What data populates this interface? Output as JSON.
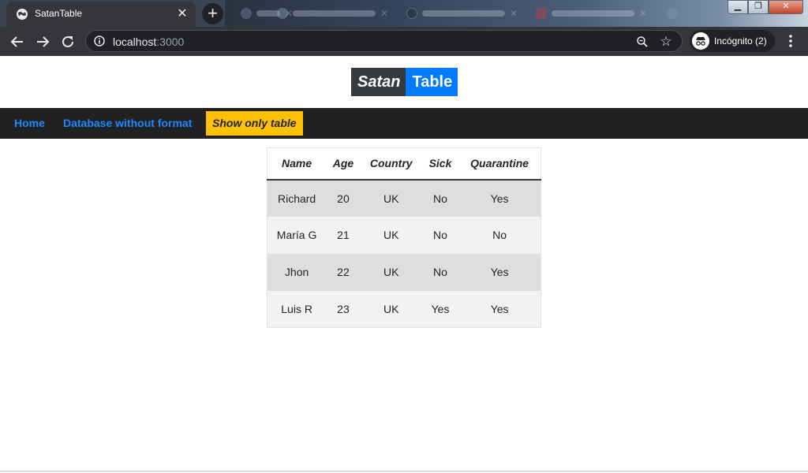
{
  "browser": {
    "tab_title": "SatanTable",
    "url_host": "localhost",
    "url_port": ":3000",
    "profile_label": "Incógnito (2)"
  },
  "site": {
    "logo_part1": "Satan",
    "logo_part2": "Table",
    "nav": {
      "home": "Home",
      "database": "Database without format",
      "active": "Show only table"
    }
  },
  "table": {
    "headers": [
      "Name",
      "Age",
      "Country",
      "Sick",
      "Quarantine"
    ],
    "rows": [
      [
        "Richard",
        "20",
        "UK",
        "No",
        "Yes"
      ],
      [
        "María G",
        "21",
        "UK",
        "No",
        "No"
      ],
      [
        "Jhon",
        "22",
        "UK",
        "No",
        "Yes"
      ],
      [
        "Luis R",
        "23",
        "UK",
        "Yes",
        "Yes"
      ]
    ]
  },
  "colors": {
    "accent_blue": "#007bff",
    "nav_link_blue": "#1e88ff",
    "active_yellow": "#ffc107",
    "navbar_dark": "#212121"
  }
}
